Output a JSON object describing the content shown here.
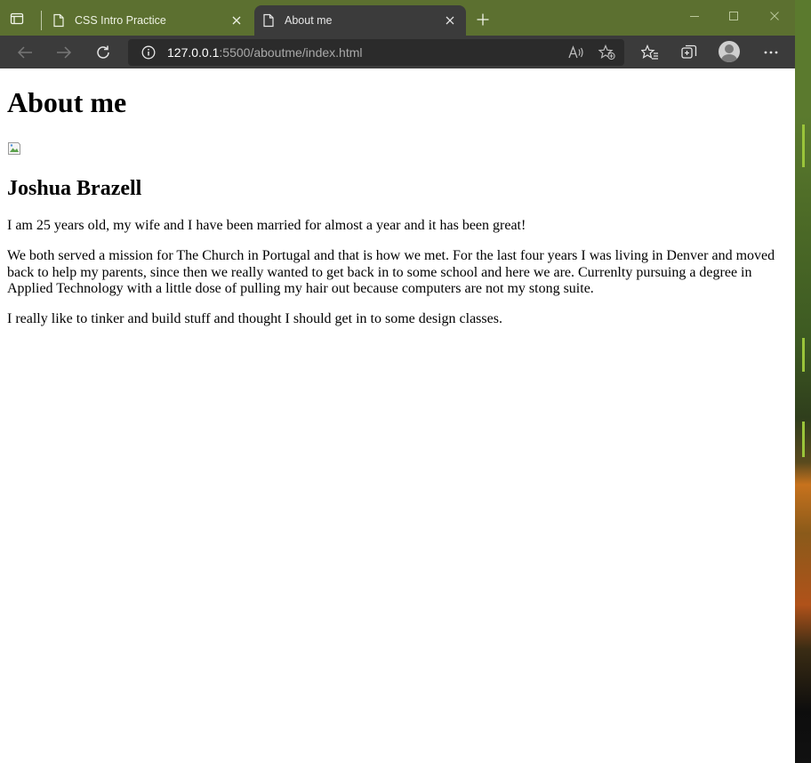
{
  "browser": {
    "tabs": [
      {
        "title": "CSS Intro Practice",
        "active": false
      },
      {
        "title": "About me",
        "active": true
      }
    ],
    "address": {
      "host": "127.0.0.1",
      "rest": ":5500/aboutme/index.html"
    },
    "colors": {
      "tabbar": "#5c7030",
      "toolbar": "#3b3b3b",
      "address_bg": "#2b2b2b"
    }
  },
  "page": {
    "heading": "About me",
    "image_alt": "",
    "name": "Joshua Brazell",
    "paragraphs": [
      "I am 25 years old, my wife and I have been married for almost a year and it has been great!",
      "We both served a mission for The Church in Portugal and that is how we met. For the last four years I was living in Denver and moved back to help my parents, since then we really wanted to get back in to some school and here we are. Currenlty pursuing a degree in Applied Technology with a little dose of pulling my hair out because computers are not my stong suite.",
      "I really like to tinker and build stuff and thought I should get in to some design classes."
    ]
  }
}
